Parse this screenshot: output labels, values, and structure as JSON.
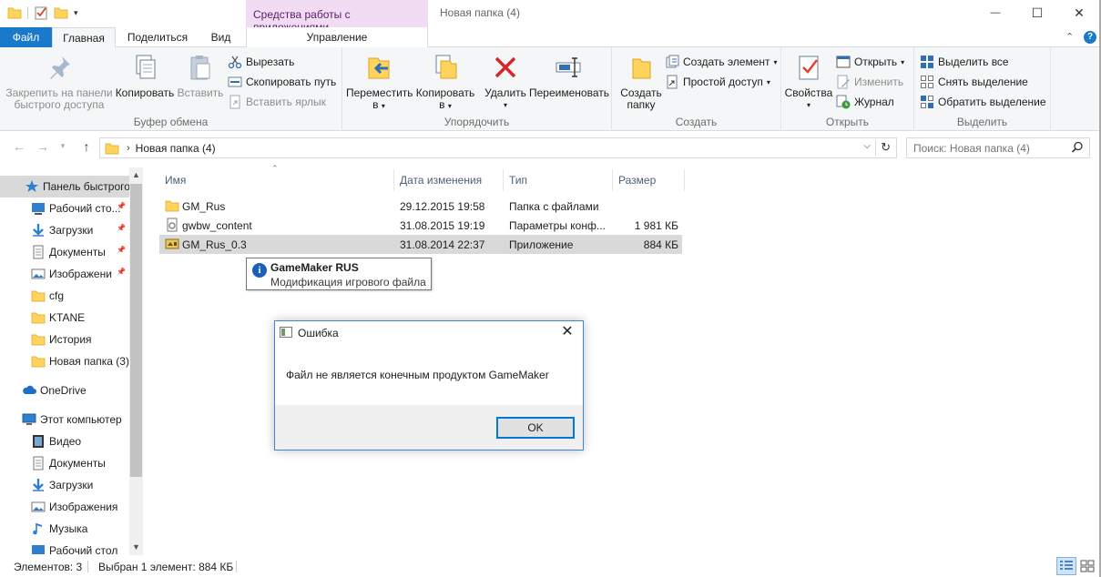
{
  "window": {
    "context_tab_header": "Средства работы с приложениями",
    "title": "Новая папка (4)",
    "minimize_glyph": "—",
    "maximize_glyph": "☐",
    "close_glyph": "✕"
  },
  "tabs": {
    "file": "Файл",
    "home": "Главная",
    "share": "Поделиться",
    "view": "Вид",
    "manage": "Управление"
  },
  "ribbon": {
    "clipboard": {
      "label": "Буфер обмена",
      "pin": "Закрепить на панели быстрого доступа",
      "pin_line1": "Закрепить на панели",
      "pin_line2": "быстрого доступа",
      "copy": "Копировать",
      "paste": "Вставить",
      "cut": "Вырезать",
      "copy_path": "Скопировать путь",
      "paste_shortcut": "Вставить ярлык"
    },
    "organize": {
      "label": "Упорядочить",
      "move_to": "Переместить",
      "move_to_sub": "в",
      "copy_to": "Копировать",
      "copy_to_sub": "в",
      "delete": "Удалить",
      "rename": "Переименовать"
    },
    "new": {
      "label": "Создать",
      "new_folder_line1": "Создать",
      "new_folder_line2": "папку",
      "new_item": "Создать элемент",
      "easy_access": "Простой доступ"
    },
    "open": {
      "label": "Открыть",
      "properties": "Свойства",
      "open": "Открыть",
      "edit": "Изменить",
      "history": "Журнал"
    },
    "select": {
      "label": "Выделить",
      "select_all": "Выделить все",
      "select_none": "Снять выделение",
      "invert": "Обратить выделение"
    }
  },
  "address": {
    "path": "Новая папка (4)",
    "search_placeholder": "Поиск: Новая папка (4)"
  },
  "nav": {
    "quick_access": "Панель быстрого доступа",
    "items": [
      {
        "label": "Рабочий сто...",
        "icon": "desktop-icon",
        "pinned": true
      },
      {
        "label": "Загрузки",
        "icon": "downloads-icon",
        "pinned": true
      },
      {
        "label": "Документы",
        "icon": "documents-icon",
        "pinned": true
      },
      {
        "label": "Изображени",
        "icon": "pictures-icon",
        "pinned": true
      },
      {
        "label": "cfg",
        "icon": "folder-icon",
        "pinned": false
      },
      {
        "label": "KTANE",
        "icon": "folder-icon",
        "pinned": false
      },
      {
        "label": "История",
        "icon": "folder-icon",
        "pinned": false
      },
      {
        "label": "Новая папка (3)",
        "icon": "folder-icon",
        "pinned": false
      }
    ],
    "onedrive": "OneDrive",
    "this_pc": "Этот компьютер",
    "pc_items": [
      {
        "label": "Видео",
        "icon": "video-icon"
      },
      {
        "label": "Документы",
        "icon": "documents-icon"
      },
      {
        "label": "Загрузки",
        "icon": "downloads-icon"
      },
      {
        "label": "Изображения",
        "icon": "pictures-icon"
      },
      {
        "label": "Музыка",
        "icon": "music-icon"
      },
      {
        "label": "Рабочий стол",
        "icon": "desktop-icon"
      }
    ],
    "pin_glyph": "📌"
  },
  "list": {
    "columns": {
      "name": "Имя",
      "date": "Дата изменения",
      "type": "Тип",
      "size": "Размер"
    },
    "rows": [
      {
        "name": "GM_Rus",
        "date": "29.12.2015 19:58",
        "type": "Папка с файлами",
        "size": "",
        "icon": "folder-icon",
        "selected": false
      },
      {
        "name": "gwbw_content",
        "date": "31.08.2015 19:19",
        "type": "Параметры конф...",
        "size": "1 981 КБ",
        "icon": "config-file-icon",
        "selected": false
      },
      {
        "name": "GM_Rus_0.3",
        "date": "31.08.2014 22:37",
        "type": "Приложение",
        "size": "884 КБ",
        "icon": "application-icon",
        "selected": true
      }
    ]
  },
  "tooltip": {
    "title": "GameMaker RUS",
    "description": "Модификация игрового файла"
  },
  "dialog": {
    "title": "Ошибка",
    "message": "Файл не является конечным продуктом GameMaker",
    "ok": "OK"
  },
  "status": {
    "count": "Элементов: 3",
    "selection": "Выбран 1 элемент: 884 КБ"
  },
  "colors": {
    "accent": "#1979ca",
    "context_tab": "#f1dcf3",
    "selection": "#d9d9d9",
    "folder": "#ffd35c"
  }
}
